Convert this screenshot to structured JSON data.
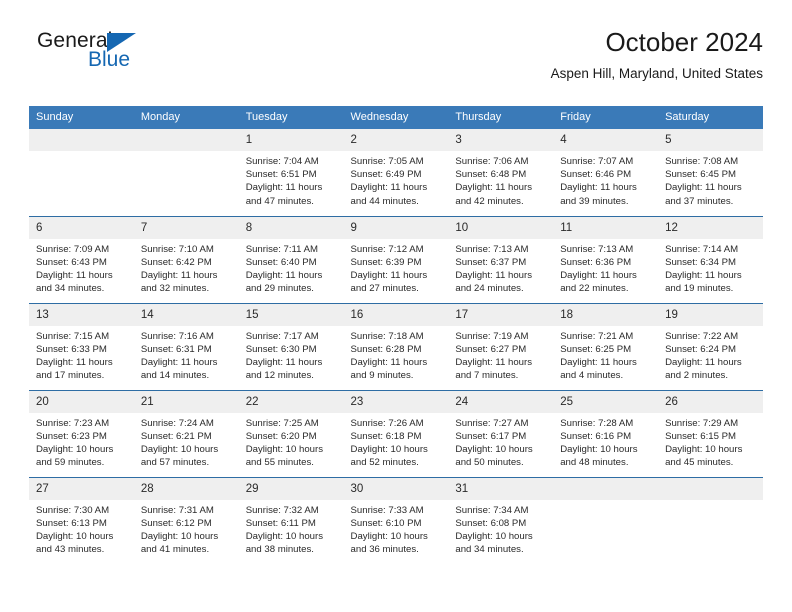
{
  "brand": {
    "name_part1": "General",
    "name_part2": "Blue",
    "triangle_icon": "blue-triangle-icon",
    "accent_color": "#1567b2"
  },
  "header": {
    "title": "October 2024",
    "subtitle": "Aspen Hill, Maryland, United States"
  },
  "theme": {
    "header_blue": "#3a7ab8",
    "row_divider_blue": "#2e6da4",
    "daynum_background": "#efefef",
    "text_color": "#2a2a2a"
  },
  "weekdays": [
    "Sunday",
    "Monday",
    "Tuesday",
    "Wednesday",
    "Thursday",
    "Friday",
    "Saturday"
  ],
  "weeks": [
    [
      {
        "day": ""
      },
      {
        "day": ""
      },
      {
        "day": "1",
        "sunrise": "Sunrise: 7:04 AM",
        "sunset": "Sunset: 6:51 PM",
        "daylight": "Daylight: 11 hours and 47 minutes."
      },
      {
        "day": "2",
        "sunrise": "Sunrise: 7:05 AM",
        "sunset": "Sunset: 6:49 PM",
        "daylight": "Daylight: 11 hours and 44 minutes."
      },
      {
        "day": "3",
        "sunrise": "Sunrise: 7:06 AM",
        "sunset": "Sunset: 6:48 PM",
        "daylight": "Daylight: 11 hours and 42 minutes."
      },
      {
        "day": "4",
        "sunrise": "Sunrise: 7:07 AM",
        "sunset": "Sunset: 6:46 PM",
        "daylight": "Daylight: 11 hours and 39 minutes."
      },
      {
        "day": "5",
        "sunrise": "Sunrise: 7:08 AM",
        "sunset": "Sunset: 6:45 PM",
        "daylight": "Daylight: 11 hours and 37 minutes."
      }
    ],
    [
      {
        "day": "6",
        "sunrise": "Sunrise: 7:09 AM",
        "sunset": "Sunset: 6:43 PM",
        "daylight": "Daylight: 11 hours and 34 minutes."
      },
      {
        "day": "7",
        "sunrise": "Sunrise: 7:10 AM",
        "sunset": "Sunset: 6:42 PM",
        "daylight": "Daylight: 11 hours and 32 minutes."
      },
      {
        "day": "8",
        "sunrise": "Sunrise: 7:11 AM",
        "sunset": "Sunset: 6:40 PM",
        "daylight": "Daylight: 11 hours and 29 minutes."
      },
      {
        "day": "9",
        "sunrise": "Sunrise: 7:12 AM",
        "sunset": "Sunset: 6:39 PM",
        "daylight": "Daylight: 11 hours and 27 minutes."
      },
      {
        "day": "10",
        "sunrise": "Sunrise: 7:13 AM",
        "sunset": "Sunset: 6:37 PM",
        "daylight": "Daylight: 11 hours and 24 minutes."
      },
      {
        "day": "11",
        "sunrise": "Sunrise: 7:13 AM",
        "sunset": "Sunset: 6:36 PM",
        "daylight": "Daylight: 11 hours and 22 minutes."
      },
      {
        "day": "12",
        "sunrise": "Sunrise: 7:14 AM",
        "sunset": "Sunset: 6:34 PM",
        "daylight": "Daylight: 11 hours and 19 minutes."
      }
    ],
    [
      {
        "day": "13",
        "sunrise": "Sunrise: 7:15 AM",
        "sunset": "Sunset: 6:33 PM",
        "daylight": "Daylight: 11 hours and 17 minutes."
      },
      {
        "day": "14",
        "sunrise": "Sunrise: 7:16 AM",
        "sunset": "Sunset: 6:31 PM",
        "daylight": "Daylight: 11 hours and 14 minutes."
      },
      {
        "day": "15",
        "sunrise": "Sunrise: 7:17 AM",
        "sunset": "Sunset: 6:30 PM",
        "daylight": "Daylight: 11 hours and 12 minutes."
      },
      {
        "day": "16",
        "sunrise": "Sunrise: 7:18 AM",
        "sunset": "Sunset: 6:28 PM",
        "daylight": "Daylight: 11 hours and 9 minutes."
      },
      {
        "day": "17",
        "sunrise": "Sunrise: 7:19 AM",
        "sunset": "Sunset: 6:27 PM",
        "daylight": "Daylight: 11 hours and 7 minutes."
      },
      {
        "day": "18",
        "sunrise": "Sunrise: 7:21 AM",
        "sunset": "Sunset: 6:25 PM",
        "daylight": "Daylight: 11 hours and 4 minutes."
      },
      {
        "day": "19",
        "sunrise": "Sunrise: 7:22 AM",
        "sunset": "Sunset: 6:24 PM",
        "daylight": "Daylight: 11 hours and 2 minutes."
      }
    ],
    [
      {
        "day": "20",
        "sunrise": "Sunrise: 7:23 AM",
        "sunset": "Sunset: 6:23 PM",
        "daylight": "Daylight: 10 hours and 59 minutes."
      },
      {
        "day": "21",
        "sunrise": "Sunrise: 7:24 AM",
        "sunset": "Sunset: 6:21 PM",
        "daylight": "Daylight: 10 hours and 57 minutes."
      },
      {
        "day": "22",
        "sunrise": "Sunrise: 7:25 AM",
        "sunset": "Sunset: 6:20 PM",
        "daylight": "Daylight: 10 hours and 55 minutes."
      },
      {
        "day": "23",
        "sunrise": "Sunrise: 7:26 AM",
        "sunset": "Sunset: 6:18 PM",
        "daylight": "Daylight: 10 hours and 52 minutes."
      },
      {
        "day": "24",
        "sunrise": "Sunrise: 7:27 AM",
        "sunset": "Sunset: 6:17 PM",
        "daylight": "Daylight: 10 hours and 50 minutes."
      },
      {
        "day": "25",
        "sunrise": "Sunrise: 7:28 AM",
        "sunset": "Sunset: 6:16 PM",
        "daylight": "Daylight: 10 hours and 48 minutes."
      },
      {
        "day": "26",
        "sunrise": "Sunrise: 7:29 AM",
        "sunset": "Sunset: 6:15 PM",
        "daylight": "Daylight: 10 hours and 45 minutes."
      }
    ],
    [
      {
        "day": "27",
        "sunrise": "Sunrise: 7:30 AM",
        "sunset": "Sunset: 6:13 PM",
        "daylight": "Daylight: 10 hours and 43 minutes."
      },
      {
        "day": "28",
        "sunrise": "Sunrise: 7:31 AM",
        "sunset": "Sunset: 6:12 PM",
        "daylight": "Daylight: 10 hours and 41 minutes."
      },
      {
        "day": "29",
        "sunrise": "Sunrise: 7:32 AM",
        "sunset": "Sunset: 6:11 PM",
        "daylight": "Daylight: 10 hours and 38 minutes."
      },
      {
        "day": "30",
        "sunrise": "Sunrise: 7:33 AM",
        "sunset": "Sunset: 6:10 PM",
        "daylight": "Daylight: 10 hours and 36 minutes."
      },
      {
        "day": "31",
        "sunrise": "Sunrise: 7:34 AM",
        "sunset": "Sunset: 6:08 PM",
        "daylight": "Daylight: 10 hours and 34 minutes."
      },
      {
        "day": ""
      },
      {
        "day": ""
      }
    ]
  ]
}
